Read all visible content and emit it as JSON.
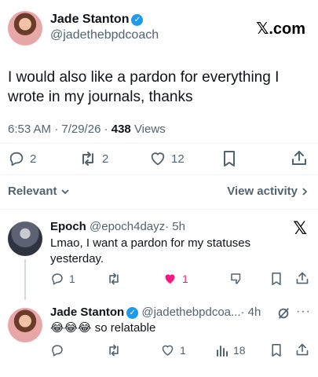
{
  "main_tweet": {
    "author_name": "Jade Stanton",
    "author_handle": "@jadethebpdcoach",
    "brand": "𝕏.com",
    "text": "I would also like a pardon for everything I wrote in my journals, thanks",
    "timestamp": "6:53 AM · 7/29/26 ·",
    "views_count": "438",
    "views_label": "Views",
    "stats": {
      "replies": "2",
      "retweets": "2",
      "likes": "12"
    }
  },
  "sort_bar": {
    "relevant_label": "Relevant",
    "view_activity_label": "View activity"
  },
  "reply_1": {
    "author_name": "Epoch",
    "author_handle": "@epoch4dayz",
    "time": "· 5h",
    "text": "Lmao, I want a pardon for my statuses yesterday.",
    "stats": {
      "replies": "1",
      "likes": "1"
    },
    "like_color": "#f91880"
  },
  "reply_2": {
    "author_name": "Jade Stanton",
    "author_handle": "@jadethebpdcoa...",
    "time": "· 4h",
    "emojis": "😂😂😂",
    "text": "so relatable",
    "stats": {
      "likes": "1",
      "views": "18"
    }
  },
  "colors": {
    "accent": "#1d9bf0",
    "muted": "#536471",
    "like": "#f91880"
  }
}
